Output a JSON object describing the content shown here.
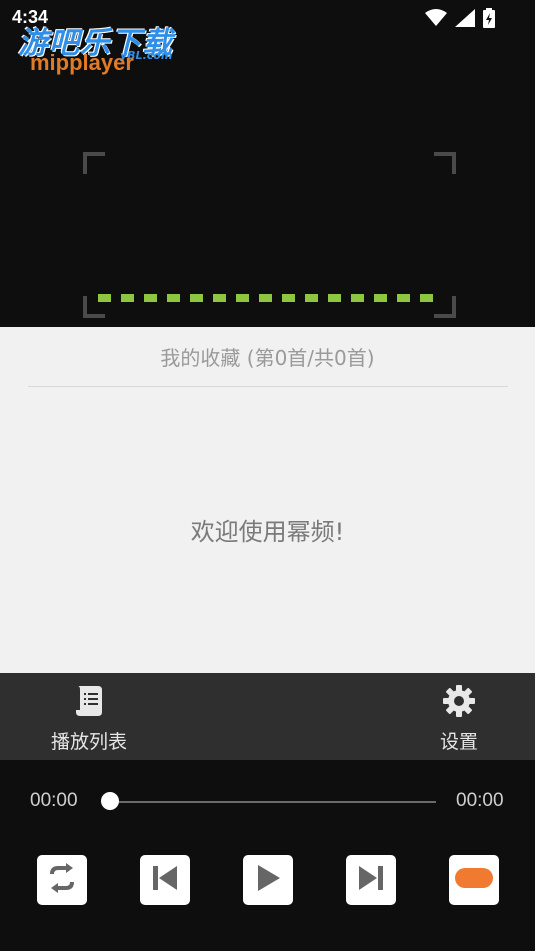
{
  "status_bar": {
    "time": "4:34"
  },
  "watermark": {
    "title": "游吧乐下载",
    "sub": "yBL.com"
  },
  "player": {
    "app_logo": "mipplayer",
    "equalizer_segments": 15
  },
  "playlist": {
    "title": "我的收藏 (第0首/共0首)",
    "welcome": "欢迎使用幂频!"
  },
  "tabs": {
    "playlist_label": "播放列表",
    "settings_label": "设置"
  },
  "progress": {
    "current": "00:00",
    "total": "00:00",
    "fraction": 0
  },
  "controls": [
    "repeat",
    "previous",
    "play",
    "next",
    "mode"
  ],
  "colors": {
    "accent_green": "#8ec63f",
    "mode_orange": "#f07a30",
    "logo_orange": "#e07b28"
  }
}
